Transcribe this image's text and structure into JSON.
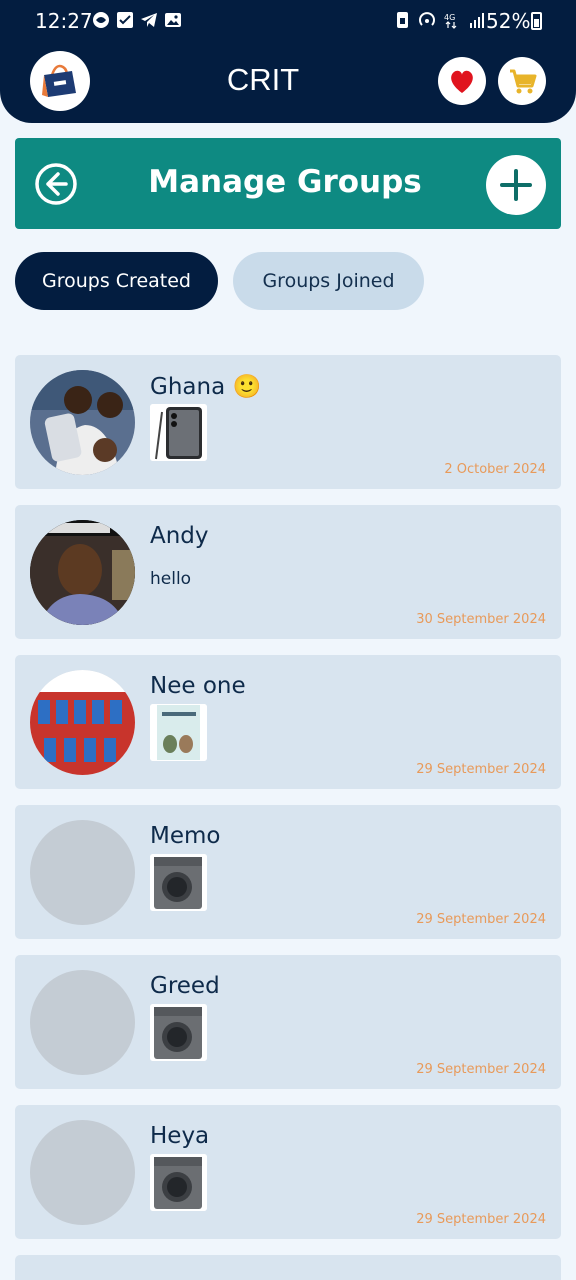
{
  "status_bar": {
    "time": "12:27",
    "battery": "52%"
  },
  "header": {
    "title": "CRIT"
  },
  "banner": {
    "title": "Manage Groups"
  },
  "tabs": [
    {
      "label": "Groups Created",
      "active": true
    },
    {
      "label": "Groups Joined",
      "active": false
    }
  ],
  "groups": [
    {
      "name": "Ghana 🙂",
      "message": "",
      "attachment": "phone-photo",
      "date": "2 October 2024",
      "avatar": "family-photo"
    },
    {
      "name": "Andy",
      "message": "hello",
      "attachment": "",
      "date": "30 September 2024",
      "avatar": "boy-photo"
    },
    {
      "name": "Nee one",
      "message": "",
      "attachment": "book-cover",
      "date": "29 September 2024",
      "avatar": "group-photo"
    },
    {
      "name": "Memo",
      "message": "",
      "attachment": "washing-machine",
      "date": "29 September 2024",
      "avatar": ""
    },
    {
      "name": "Greed",
      "message": "",
      "attachment": "washing-machine",
      "date": "29 September 2024",
      "avatar": ""
    },
    {
      "name": "Heya",
      "message": "",
      "attachment": "washing-machine",
      "date": "29 September 2024",
      "avatar": ""
    }
  ],
  "colors": {
    "header_bg": "#031d40",
    "banner_bg": "#0e8a82",
    "card_bg": "#d8e4ef",
    "date_color": "#e89a5a",
    "favorite_red": "#e0141e",
    "cart_gold": "#e8b42a"
  }
}
